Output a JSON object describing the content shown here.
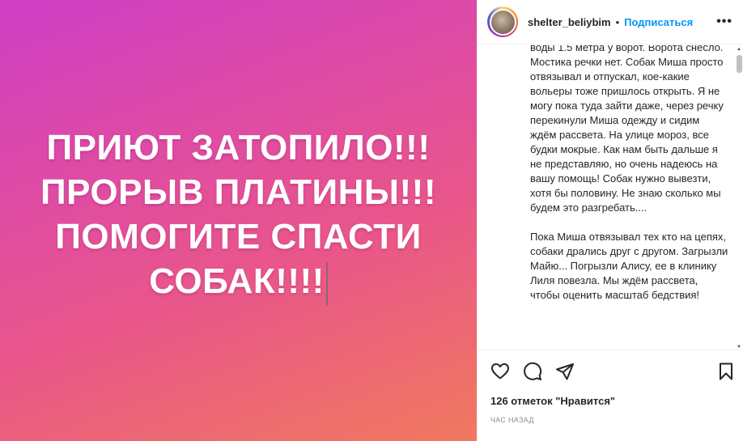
{
  "media": {
    "lines": [
      "ПРИЮТ ЗАТОПИЛО!!!",
      "ПРОРЫВ ПЛАТИНЫ!!!",
      "ПОМОГИТЕ СПАСТИ",
      "СОБАК!!!!"
    ]
  },
  "header": {
    "username": "shelter_beliybim",
    "separator": "•",
    "follow_label": "Подписаться",
    "more_label": "•••"
  },
  "caption": {
    "paragraphs": [
      "воды 1.5 метра у ворот. Ворота снесло. Мостика речки нет. Собак Миша просто отвязывал и отпускал, кое-какие вольеры тоже пришлось открыть. Я не могу пока туда зайти даже, через речку перекинули Миша одежду и сидим ждём рассвета. На улице мороз, все будки мокрые. Как нам быть дальше я не представляю, но очень надеюсь на вашу помощь! Собак нужно вывезти, хотя бы половину. Не знаю сколько мы будем это разгребать....",
      "Пока Миша отвязывал тех кто на цепях, собаки дрались друг с другом. Загрызли Майю... Погрызли Алису, ее в клинику Лиля повезла. Мы ждём рассвета, чтобы оценить масштаб бедствия!"
    ]
  },
  "actions": {
    "icons": [
      "heart-icon",
      "comment-icon",
      "share-icon",
      "bookmark-icon"
    ]
  },
  "likes_label": "126 отметок \"Нравится\"",
  "time_label": "час назад",
  "colors": {
    "gradient_start": "#cf3fc7",
    "gradient_end": "#f0795e",
    "follow": "#0095f6",
    "muted": "#8e8e8e"
  }
}
